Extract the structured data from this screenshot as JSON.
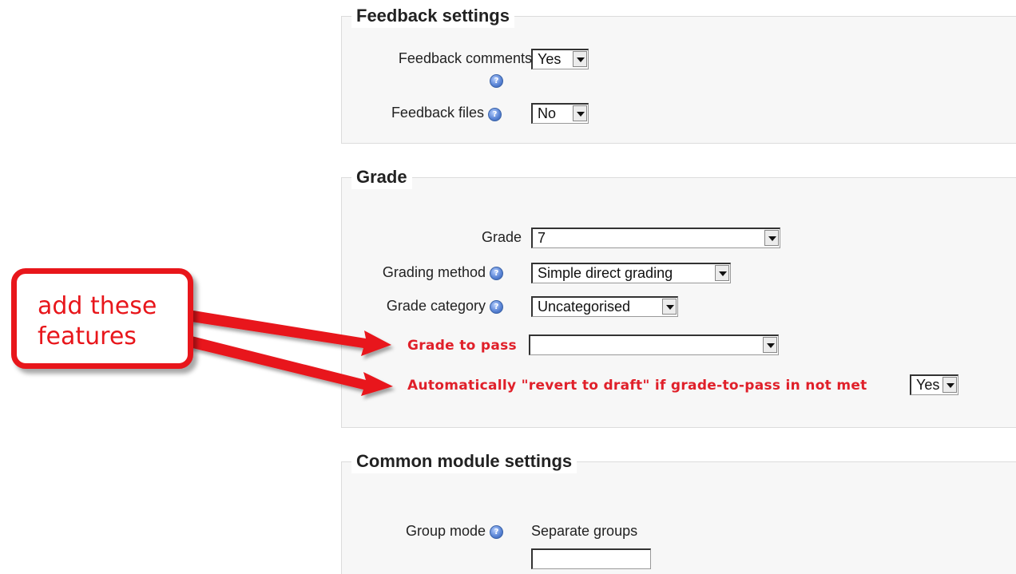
{
  "feedback_settings": {
    "legend": "Feedback settings",
    "feedback_comments": {
      "label": "Feedback comments",
      "value": "Yes"
    },
    "feedback_files": {
      "label": "Feedback files",
      "value": "No"
    }
  },
  "grade": {
    "legend": "Grade",
    "grade": {
      "label": "Grade",
      "value": "7"
    },
    "grading_method": {
      "label": "Grading method",
      "value": "Simple direct grading"
    },
    "grade_category": {
      "label": "Grade category",
      "value": "Uncategorised"
    },
    "grade_to_pass": {
      "label": "Grade to pass",
      "value": ""
    },
    "revert_to_draft": {
      "label": "Automatically \"revert to draft\" if grade-to-pass in not met",
      "value": "Yes"
    }
  },
  "common_module_settings": {
    "legend": "Common module settings",
    "group_mode": {
      "label": "Group mode",
      "value": "Separate groups"
    }
  },
  "annotation": {
    "text_line1": "add these",
    "text_line2": "features",
    "color": "#e8161b"
  },
  "icons": {
    "help": "help-icon"
  }
}
